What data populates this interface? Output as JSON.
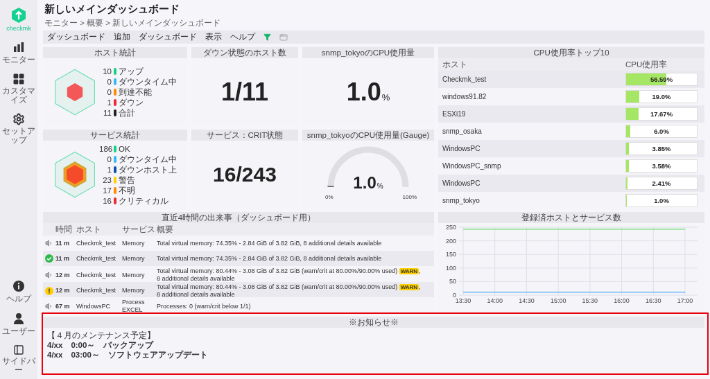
{
  "sidebar": {
    "logo": "checkmk",
    "items": [
      {
        "kind": "monitor",
        "label": "モニター"
      },
      {
        "kind": "customize",
        "label": "カスタマイズ"
      },
      {
        "kind": "setup",
        "label": "セットアップ"
      }
    ],
    "bottom_items": [
      {
        "kind": "help",
        "label": "ヘルプ"
      },
      {
        "kind": "user",
        "label": "ユーザー"
      },
      {
        "kind": "sidebar",
        "label": "サイドバー"
      }
    ]
  },
  "header": {
    "title": "新しいメインダッシュボード",
    "breadcrumb": "モニター > 概要 > 新しいメインダッシュボード"
  },
  "menubar": [
    "ダッシュボード",
    "追加",
    "ダッシュボード",
    "表示",
    "ヘルプ"
  ],
  "host_stats": {
    "title": "ホスト統計",
    "kind": "host",
    "items": [
      {
        "count": "10",
        "label": "アップ",
        "color": "#13d389"
      },
      {
        "count": "0",
        "label": "ダウンタイム中",
        "color": "#39b9f2"
      },
      {
        "count": "0",
        "label": "到達不能",
        "color": "#ff8a00"
      },
      {
        "count": "1",
        "label": "ダウン",
        "color": "#ee2b33"
      },
      {
        "count": "11",
        "label": "合計",
        "color": "#222222"
      }
    ]
  },
  "down_hosts": {
    "title": "ダウン状態のホスト数",
    "value": "1/11"
  },
  "snmp_cpu": {
    "title": "snmp_tokyoのCPU使用量",
    "value": "1.0",
    "unit": "%"
  },
  "service_stats": {
    "title": "サービス統計",
    "kind": "service",
    "items": [
      {
        "count": "186",
        "label": "OK",
        "color": "#13d389"
      },
      {
        "count": "0",
        "label": "ダウンタイム中",
        "color": "#39b9f2"
      },
      {
        "count": "1",
        "label": "ダウンホスト上",
        "color": "#1050a8"
      },
      {
        "count": "23",
        "label": "警告",
        "color": "#ffd000"
      },
      {
        "count": "17",
        "label": "不明",
        "color": "#ff8a00"
      },
      {
        "count": "16",
        "label": "クリティカル",
        "color": "#ee2b33"
      }
    ]
  },
  "crit_services": {
    "title": "サービス：CRIT状態",
    "value": "16/243"
  },
  "gauge": {
    "title": "snmp_tokyoのCPU使用量(Gauge)",
    "value": "1.0",
    "unit": "%",
    "level": 0.01,
    "min": "0%",
    "max": "100%"
  },
  "cpu_top": {
    "title": "CPU使用率トップ10",
    "columns": [
      "ホスト",
      "CPU使用率"
    ],
    "rows": [
      {
        "host": "Checkmk_test",
        "value": "56.59%",
        "level": 0.5659
      },
      {
        "host": "windows91.82",
        "value": "19.0%",
        "level": 0.19
      },
      {
        "host": "ESXi19",
        "value": "17.67%",
        "level": 0.1767
      },
      {
        "host": "snmp_osaka",
        "value": "6.0%",
        "level": 0.06
      },
      {
        "host": "WindowsPC",
        "value": "3.85%",
        "level": 0.0385
      },
      {
        "host": "WindowsPC_snmp",
        "value": "3.58%",
        "level": 0.0358
      },
      {
        "host": "WindowsPC",
        "value": "2.41%",
        "level": 0.0241
      },
      {
        "host": "snmp_tokyo",
        "value": "1.0%",
        "level": 0.01
      }
    ]
  },
  "events": {
    "title": "直近4時間の出来事（ダッシュボード用）",
    "columns": [
      "時間",
      "ホスト",
      "サービス",
      "概要"
    ],
    "rows": [
      {
        "kind": "notification",
        "time": "11 m",
        "host": "Checkmk_test",
        "service": "Memory",
        "summary": "Total virtual memory: 74.35% - 2.84 GiB of 3.82 GiB, 8 additional details available"
      },
      {
        "kind": "ok",
        "time": "11 m",
        "host": "Checkmk_test",
        "service": "Memory",
        "summary": "Total virtual memory: 74.35% - 2.84 GiB of 3.82 GiB, 8 additional details available"
      },
      {
        "kind": "notification",
        "time": "12 m",
        "host": "Checkmk_test",
        "service": "Memory",
        "summary": "Total virtual memory: 80.44% - 3.08 GiB of 3.82 GiB (warn/crit at 80.00%/90.00% used)",
        "badge": "WARN",
        "tail": ",",
        "detail": "8 additional details available"
      },
      {
        "kind": "warn",
        "time": "12 m",
        "host": "Checkmk_test",
        "service": "Memory",
        "summary": "Total virtual memory: 80.44% - 3.08 GiB of 3.82 GiB (warn/crit at 80.00%/90.00% used)",
        "badge": "WARN",
        "tail": ",",
        "detail": "8 additional details available"
      },
      {
        "kind": "notification",
        "time": "67 m",
        "host": "WindowsPC",
        "service": "Process EXCEL",
        "summary": "Processes: 0 (warn/crit below 1/1)"
      }
    ]
  },
  "registered": {
    "title": "登録済ホストとサービス数",
    "chart_data": {
      "type": "line",
      "x": [
        "13:30",
        "14:00",
        "14:30",
        "15:00",
        "15:30",
        "16:00",
        "16:30",
        "17:00"
      ],
      "ylim": [
        0,
        250
      ],
      "yticks": [
        0,
        50,
        100,
        150,
        200,
        250
      ],
      "grid": true,
      "series": [
        {
          "color": "#7ee07e",
          "values": [
            243,
            243,
            243,
            243,
            243,
            243,
            243,
            243
          ]
        },
        {
          "color": "#4aa8ff",
          "values": [
            11,
            11,
            11,
            11,
            11,
            11,
            11,
            11
          ]
        }
      ]
    }
  },
  "notice": {
    "title": "※お知らせ※",
    "highlighted": true,
    "lines": [
      "【４月のメンテナンス予定】",
      "4/xx　0:00～　バックアップ",
      "4/xx　03:00～　ソフトウェアアップデート"
    ]
  }
}
